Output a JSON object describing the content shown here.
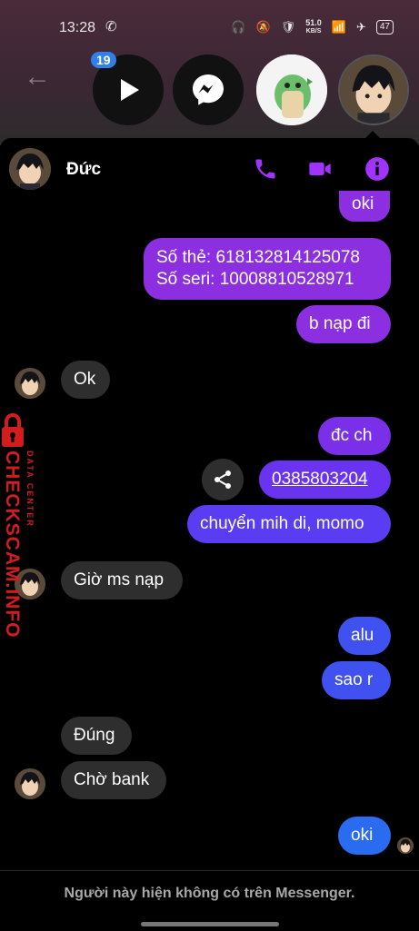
{
  "status_bar": {
    "time": "13:28",
    "speed_value": "51.0",
    "speed_unit": "KB/S",
    "battery": "47"
  },
  "chat_heads": {
    "badge_count": "19"
  },
  "header": {
    "contact_name": "Đức"
  },
  "messages": [
    {
      "side": "out",
      "text": "oki"
    },
    {
      "side": "out",
      "text": "Số thẻ: 618132814125078\nSố seri: 10008810528971"
    },
    {
      "side": "out",
      "text": "b nạp đi"
    },
    {
      "side": "in",
      "text": "Ok"
    },
    {
      "side": "out",
      "text": "đc ch"
    },
    {
      "side": "out",
      "text": "0385803204"
    },
    {
      "side": "out",
      "text": "chuyển mih di, momo"
    },
    {
      "side": "in",
      "text": "Giờ ms nạp"
    },
    {
      "side": "out",
      "text": "alu"
    },
    {
      "side": "out",
      "text": "sao r"
    },
    {
      "side": "in",
      "text": "Đúng"
    },
    {
      "side": "in",
      "text": "Chờ bank"
    },
    {
      "side": "out",
      "text": "oki"
    }
  ],
  "footer": {
    "notice": "Người này hiện không có trên Messenger."
  },
  "watermark": {
    "main": "CHECKSCAM.INFO",
    "sub": "DATA CENTER"
  },
  "colors": {
    "accent_purple": "#8b2fe0",
    "accent_blue": "#2a6cf0",
    "incoming_bubble": "#2e2e2e",
    "icon_purple": "#a033ff"
  }
}
